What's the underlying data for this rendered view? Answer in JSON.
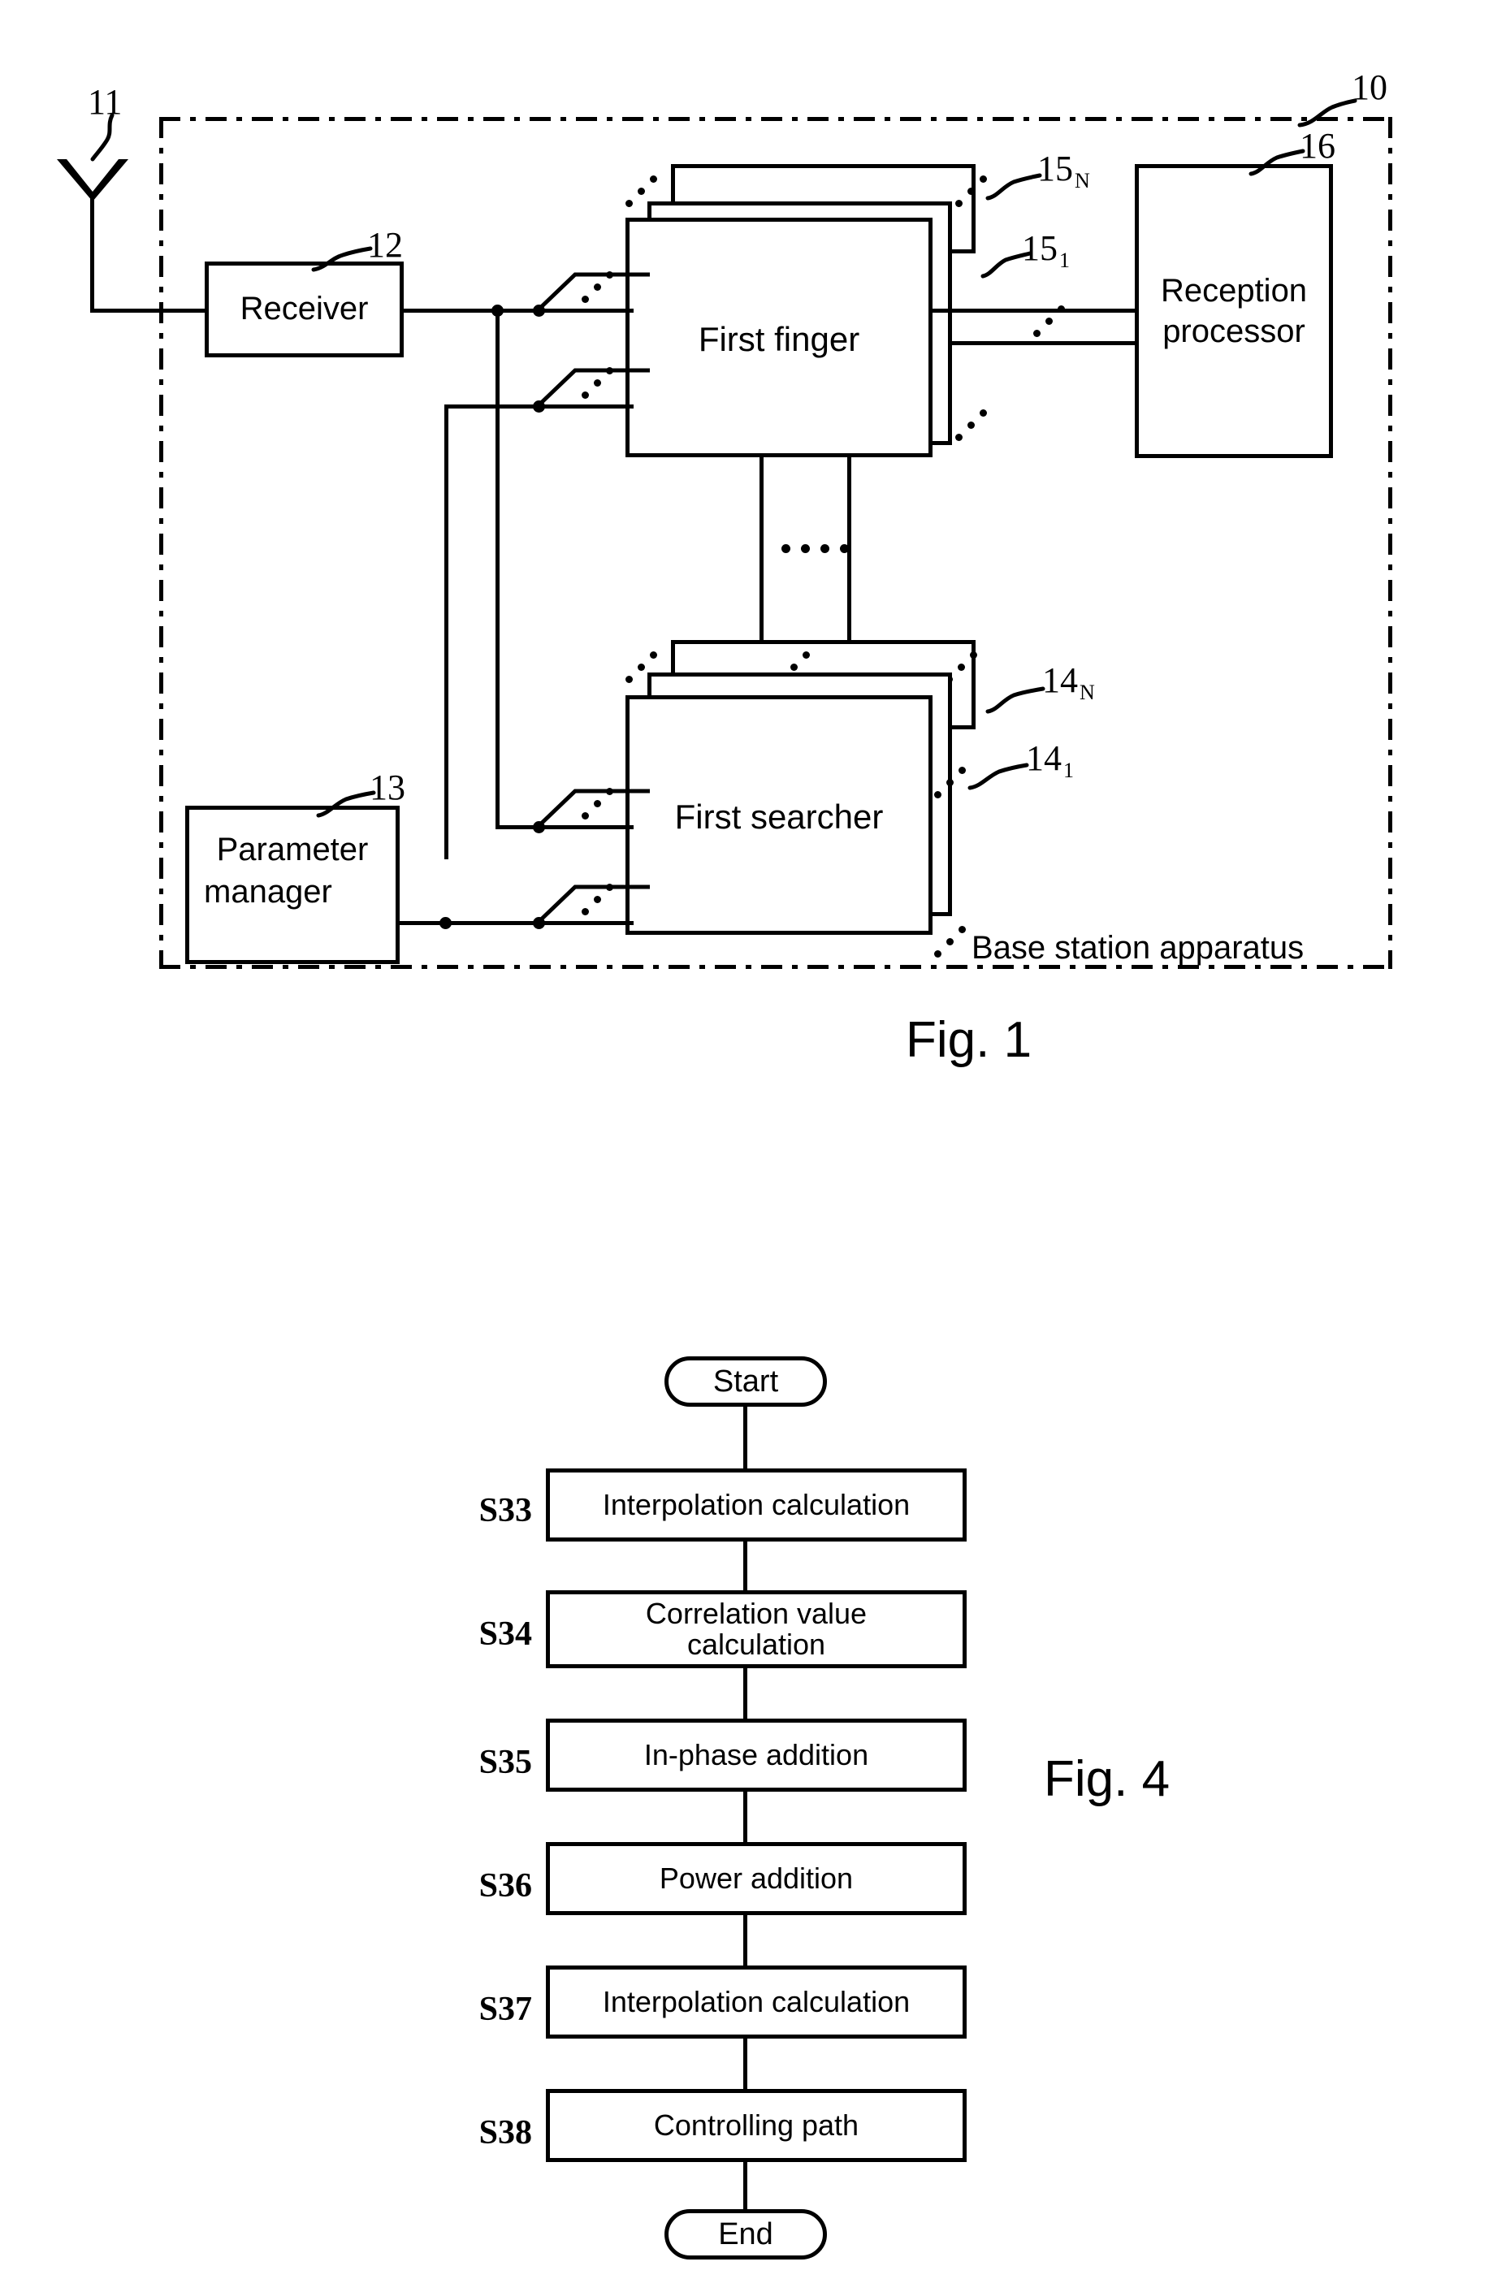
{
  "figure1": {
    "caption": "Fig. 1",
    "enclosure_label": "Base station apparatus",
    "enclosure_ref": "10",
    "blocks": [
      {
        "id": "receiver",
        "label": "Receiver",
        "ref": "12"
      },
      {
        "id": "parameter",
        "label": "Parameter\nmanager",
        "ref": "13"
      },
      {
        "id": "finger",
        "label": "First finger",
        "ref_top": "15",
        "ref_top_sub": "N",
        "ref_bottom": "15",
        "ref_bottom_sub": "1"
      },
      {
        "id": "searcher",
        "label": "First searcher",
        "ref_top": "14",
        "ref_top_sub": "N",
        "ref_bottom": "14",
        "ref_bottom_sub": "1"
      },
      {
        "id": "processor",
        "label": "Reception\nprocessor",
        "ref": "16"
      }
    ],
    "antenna_ref": "11",
    "labels": {
      "receiver": "Receiver",
      "parameter_line1": "Parameter",
      "parameter_line2": "manager",
      "first_finger": "First finger",
      "first_searcher": "First searcher",
      "reception_line1": "Reception",
      "reception_line2": "processor",
      "base_station": "Base station apparatus"
    },
    "refs": {
      "antenna": "11",
      "receiver": "12",
      "parameter_manager": "13",
      "searcher_n": "14",
      "searcher_n_sub": "N",
      "searcher_1": "14",
      "searcher_1_sub": "1",
      "finger_n": "15",
      "finger_n_sub": "N",
      "finger_1": "15",
      "finger_1_sub": "1",
      "processor": "16",
      "apparatus": "10"
    }
  },
  "figure4": {
    "caption": "Fig. 4",
    "start_label": "Start",
    "end_label": "End",
    "steps": [
      {
        "tag": "S33",
        "label": "Interpolation calculation"
      },
      {
        "tag": "S34",
        "label": "Correlation value\ncalculation"
      },
      {
        "tag": "S35",
        "label": "In-phase addition"
      },
      {
        "tag": "S36",
        "label": "Power addition"
      },
      {
        "tag": "S37",
        "label": "Interpolation calculation"
      },
      {
        "tag": "S38",
        "label": "Controlling path"
      }
    ],
    "step_tags": {
      "s33": "S33",
      "s34": "S34",
      "s35": "S35",
      "s36": "S36",
      "s37": "S37",
      "s38": "S38"
    },
    "step_labels": {
      "s33": "Interpolation calculation",
      "s34_line1": "Correlation value",
      "s34_line2": "calculation",
      "s35": "In-phase addition",
      "s36": "Power addition",
      "s37": "Interpolation calculation",
      "s38": "Controlling path"
    }
  },
  "colors": {
    "ink": "#000000",
    "paper": "#ffffff"
  }
}
